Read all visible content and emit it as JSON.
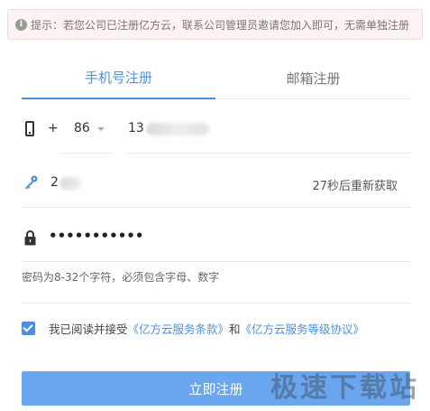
{
  "notice": {
    "icon": "info-icon",
    "text": "提示：若您公司已注册亿方云，联系公司管理员邀请您加入即可，无需单独注册"
  },
  "tabs": [
    {
      "label": "手机号注册",
      "active": true
    },
    {
      "label": "邮箱注册",
      "active": false
    }
  ],
  "phone": {
    "icon": "phone-icon",
    "plus": "+",
    "country_code": "86",
    "value": "13"
  },
  "code": {
    "icon": "key-icon",
    "value": "2",
    "resend_label": "27秒后重新获取"
  },
  "password": {
    "icon": "lock-icon",
    "value": "•••••••••••"
  },
  "password_hint": "密码为8-32个字符，必须包含字母、数字",
  "agreement": {
    "checked": true,
    "prefix": "我已阅读并接受",
    "terms_link": "《亿方云服务条款》",
    "conjunction": "和",
    "sla_link": "《亿方云服务等级协议》"
  },
  "submit_label": "立即注册",
  "watermark": "极速下载站",
  "colors": {
    "accent": "#4a90e2",
    "button": "#6aa5f0",
    "notice_bg": "#fdf3f2"
  }
}
